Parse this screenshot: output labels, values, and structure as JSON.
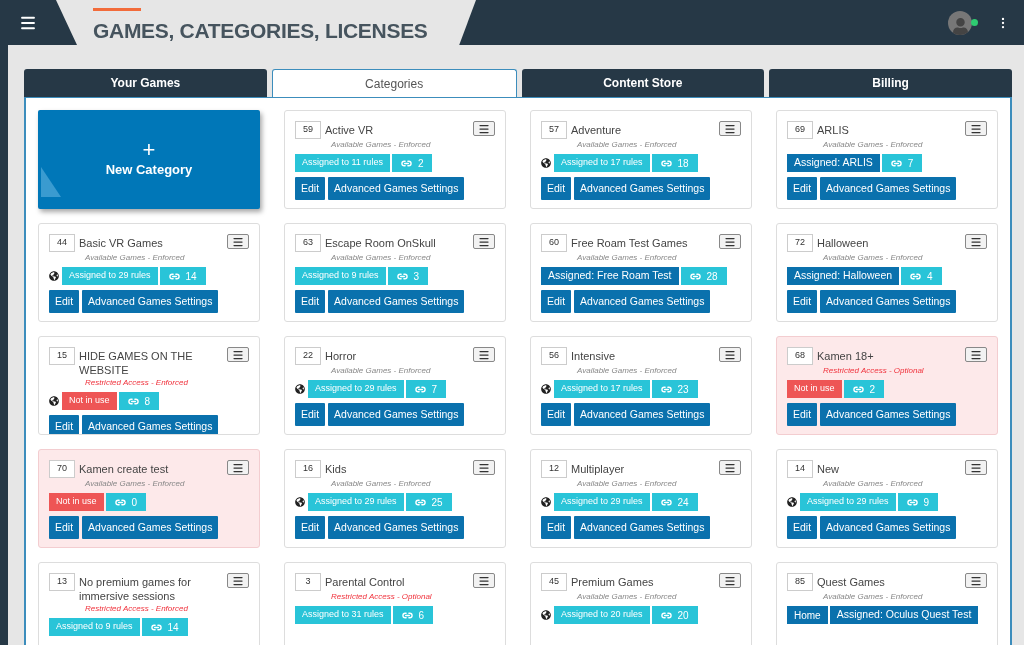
{
  "header": {
    "title": "GAMES, CATEGORIES, LICENSES",
    "user_online": true
  },
  "tabs": [
    {
      "label": "Your Games",
      "selected": false
    },
    {
      "label": "Categories",
      "selected": true
    },
    {
      "label": "Content Store",
      "selected": false
    },
    {
      "label": "Billing",
      "selected": false
    }
  ],
  "new_category": {
    "icon": "+",
    "label": "New Category"
  },
  "cards": [
    {
      "id": "59",
      "name": "Active VR",
      "access": {
        "text": "Available Games - Enforced",
        "restricted": false
      },
      "globe": false,
      "highlighted": false,
      "badges": [
        {
          "kind": "rules",
          "text": "Assigned to 11 rules"
        },
        {
          "kind": "games",
          "text": "2"
        }
      ],
      "buttons": [
        "Edit",
        "Advanced Games Settings"
      ]
    },
    {
      "id": "57",
      "name": "Adventure",
      "access": {
        "text": "Available Games - Enforced",
        "restricted": false
      },
      "globe": true,
      "highlighted": false,
      "badges": [
        {
          "kind": "rules",
          "text": "Assigned to 17 rules"
        },
        {
          "kind": "games",
          "text": "18"
        }
      ],
      "buttons": [
        "Edit",
        "Advanced Games Settings"
      ]
    },
    {
      "id": "69",
      "name": "ARLIS",
      "access": {
        "text": "Available Games - Enforced",
        "restricted": false
      },
      "globe": false,
      "highlighted": false,
      "badges": [
        {
          "kind": "assigned",
          "text": "Assigned: ARLIS"
        },
        {
          "kind": "games",
          "text": "7"
        }
      ],
      "buttons": [
        "Edit",
        "Advanced Games Settings"
      ]
    },
    {
      "id": "44",
      "name": "Basic VR Games",
      "access": {
        "text": "Available Games - Enforced",
        "restricted": false
      },
      "globe": true,
      "highlighted": false,
      "badges": [
        {
          "kind": "rules",
          "text": "Assigned to 29 rules"
        },
        {
          "kind": "games",
          "text": "14"
        }
      ],
      "buttons": [
        "Edit",
        "Advanced Games Settings"
      ]
    },
    {
      "id": "63",
      "name": "Escape Room OnSkull",
      "access": {
        "text": "Available Games - Enforced",
        "restricted": false
      },
      "globe": false,
      "highlighted": false,
      "badges": [
        {
          "kind": "rules",
          "text": "Assigned to 9 rules"
        },
        {
          "kind": "games",
          "text": "3"
        }
      ],
      "buttons": [
        "Edit",
        "Advanced Games Settings"
      ]
    },
    {
      "id": "60",
      "name": "Free Roam Test Games",
      "access": {
        "text": "Available Games - Enforced",
        "restricted": false
      },
      "globe": false,
      "highlighted": false,
      "badges": [
        {
          "kind": "assigned",
          "text": "Assigned: Free Roam Test"
        },
        {
          "kind": "games",
          "text": "28"
        }
      ],
      "buttons": [
        "Edit",
        "Advanced Games Settings"
      ]
    },
    {
      "id": "72",
      "name": "Halloween",
      "access": {
        "text": "Available Games - Enforced",
        "restricted": false
      },
      "globe": false,
      "highlighted": false,
      "badges": [
        {
          "kind": "assigned",
          "text": "Assigned: Halloween"
        },
        {
          "kind": "games",
          "text": "4"
        }
      ],
      "buttons": [
        "Edit",
        "Advanced Games Settings"
      ]
    },
    {
      "id": "15",
      "name": "HIDE GAMES ON THE WEBSITE",
      "access": {
        "text": "Restricted Access - Enforced",
        "restricted": true
      },
      "globe": true,
      "highlighted": false,
      "badges": [
        {
          "kind": "unused",
          "text": "Not in use"
        },
        {
          "kind": "games",
          "text": "8"
        }
      ],
      "buttons": [
        "Edit",
        "Advanced Games Settings"
      ]
    },
    {
      "id": "22",
      "name": "Horror",
      "access": {
        "text": "Available Games - Enforced",
        "restricted": false
      },
      "globe": true,
      "highlighted": false,
      "badges": [
        {
          "kind": "rules",
          "text": "Assigned to 29 rules"
        },
        {
          "kind": "games",
          "text": "7"
        }
      ],
      "buttons": [
        "Edit",
        "Advanced Games Settings"
      ]
    },
    {
      "id": "56",
      "name": "Intensive",
      "access": {
        "text": "Available Games - Enforced",
        "restricted": false
      },
      "globe": true,
      "highlighted": false,
      "badges": [
        {
          "kind": "rules",
          "text": "Assigned to 17 rules"
        },
        {
          "kind": "games",
          "text": "23"
        }
      ],
      "buttons": [
        "Edit",
        "Advanced Games Settings"
      ]
    },
    {
      "id": "68",
      "name": "Kamen 18+",
      "access": {
        "text": "Restricted Access - Optional",
        "restricted": true
      },
      "globe": false,
      "highlighted": true,
      "badges": [
        {
          "kind": "unused",
          "text": "Not in use"
        },
        {
          "kind": "games",
          "text": "2"
        }
      ],
      "buttons": [
        "Edit",
        "Advanced Games Settings"
      ]
    },
    {
      "id": "70",
      "name": "Kamen create test",
      "access": {
        "text": "Available Games - Enforced",
        "restricted": false
      },
      "globe": false,
      "highlighted": true,
      "badges": [
        {
          "kind": "unused",
          "text": "Not in use"
        },
        {
          "kind": "games",
          "text": "0"
        }
      ],
      "buttons": [
        "Edit",
        "Advanced Games Settings"
      ]
    },
    {
      "id": "16",
      "name": "Kids",
      "access": {
        "text": "Available Games - Enforced",
        "restricted": false
      },
      "globe": true,
      "highlighted": false,
      "badges": [
        {
          "kind": "rules",
          "text": "Assigned to 29 rules"
        },
        {
          "kind": "games",
          "text": "25"
        }
      ],
      "buttons": [
        "Edit",
        "Advanced Games Settings"
      ]
    },
    {
      "id": "12",
      "name": "Multiplayer",
      "access": {
        "text": "Available Games - Enforced",
        "restricted": false
      },
      "globe": true,
      "highlighted": false,
      "badges": [
        {
          "kind": "rules",
          "text": "Assigned to 29 rules"
        },
        {
          "kind": "games",
          "text": "24"
        }
      ],
      "buttons": [
        "Edit",
        "Advanced Games Settings"
      ]
    },
    {
      "id": "14",
      "name": "New",
      "access": {
        "text": "Available Games - Enforced",
        "restricted": false
      },
      "globe": true,
      "highlighted": false,
      "badges": [
        {
          "kind": "rules",
          "text": "Assigned to 29 rules"
        },
        {
          "kind": "games",
          "text": "9"
        }
      ],
      "buttons": [
        "Edit",
        "Advanced Games Settings"
      ]
    },
    {
      "id": "13",
      "name": "No premium games for immersive sessions",
      "access": {
        "text": "Restricted Access - Enforced",
        "restricted": true
      },
      "globe": false,
      "highlighted": false,
      "badges": [
        {
          "kind": "rules",
          "text": "Assigned to 9 rules"
        },
        {
          "kind": "games",
          "text": "14"
        }
      ]
    },
    {
      "id": "3",
      "name": "Parental Control",
      "access": {
        "text": "Restricted Access - Optional",
        "restricted": true
      },
      "globe": false,
      "highlighted": false,
      "badges": [
        {
          "kind": "rules",
          "text": "Assigned to 31 rules"
        },
        {
          "kind": "games",
          "text": "6"
        }
      ]
    },
    {
      "id": "45",
      "name": "Premium Games",
      "access": {
        "text": "Available Games - Enforced",
        "restricted": false
      },
      "globe": true,
      "highlighted": false,
      "badges": [
        {
          "kind": "rules",
          "text": "Assigned to 20 rules"
        },
        {
          "kind": "games",
          "text": "20"
        }
      ]
    },
    {
      "id": "85",
      "name": "Quest Games",
      "access": {
        "text": "Available Games - Enforced",
        "restricted": false
      },
      "globe": false,
      "highlighted": false,
      "badges": [
        {
          "kind": "home",
          "text": "Home"
        },
        {
          "kind": "assigned",
          "text": "Assigned: Oculus Quest Test"
        }
      ]
    }
  ]
}
